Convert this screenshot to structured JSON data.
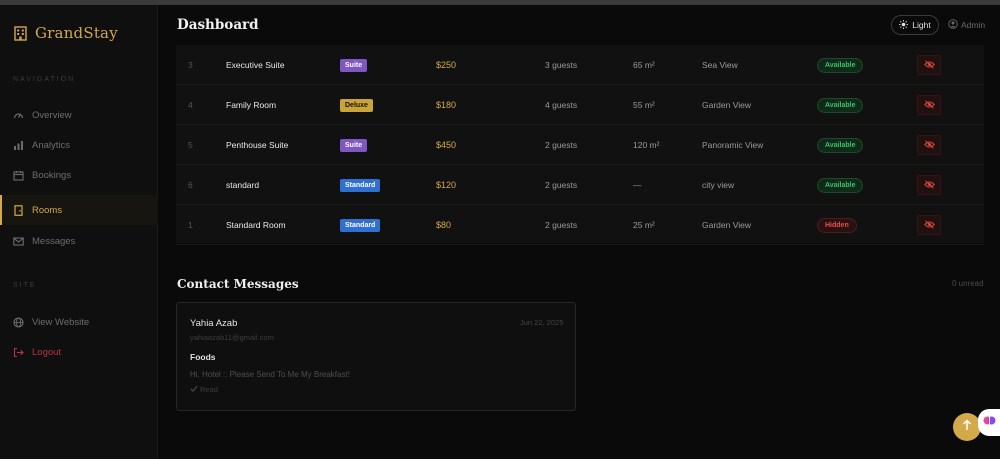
{
  "brand": {
    "name": "GrandStay",
    "accent": "#d4a94a"
  },
  "sidebar": {
    "section_main": "Navigation",
    "items": [
      {
        "label": "Overview",
        "icon": "gauge-icon"
      },
      {
        "label": "Analytics",
        "icon": "bar-chart-icon"
      },
      {
        "label": "Bookings",
        "icon": "calendar-icon"
      },
      {
        "label": "Rooms",
        "icon": "door-icon",
        "active": true
      },
      {
        "label": "Messages",
        "icon": "envelope-icon"
      }
    ],
    "section_site": "Site",
    "site_items": [
      {
        "label": "View Website",
        "icon": "globe-icon"
      },
      {
        "label": "Logout",
        "icon": "logout-icon"
      }
    ]
  },
  "header": {
    "title": "Dashboard",
    "theme_label": "Light",
    "user_label": "Admin"
  },
  "rooms": [
    {
      "id": "3",
      "name": "Executive Suite",
      "type": "Suite",
      "type_color": "#7e57c2",
      "price": "$250",
      "guests": "3 guests",
      "size": "65 m²",
      "view": "Sea View",
      "status": "Available"
    },
    {
      "id": "4",
      "name": "Family Room",
      "type": "Deluxe",
      "type_color": "#c9a43a",
      "price": "$180",
      "guests": "4 guests",
      "size": "55 m²",
      "view": "Garden View",
      "status": "Available"
    },
    {
      "id": "5",
      "name": "Penthouse Suite",
      "type": "Suite",
      "type_color": "#7e57c2",
      "price": "$450",
      "guests": "2 guests",
      "size": "120 m²",
      "view": "Panoramic View",
      "status": "Available"
    },
    {
      "id": "6",
      "name": "standard",
      "type": "Standard",
      "type_color": "#2f6fd0",
      "price": "$120",
      "guests": "2 guests",
      "size": "—",
      "view": "city view",
      "status": "Available"
    },
    {
      "id": "1",
      "name": "Standard Room",
      "type": "Standard",
      "type_color": "#2f6fd0",
      "price": "$80",
      "guests": "2 guests",
      "size": "25 m²",
      "view": "Garden View",
      "status": "Hidden"
    }
  ],
  "status_colors": {
    "Available": {
      "text": "#3fbf6a",
      "bg": "#0f2a18",
      "border": "#1e4a2c"
    },
    "Hidden": {
      "text": "#e5534b",
      "bg": "#2a1010",
      "border": "#4a1e1e"
    }
  },
  "messages": {
    "title": "Contact Messages",
    "unread_label": "0 unread",
    "items": [
      {
        "name": "Yahia Azab",
        "date": "Jun 22, 2025",
        "email": "yahiaazab11@gmail.com",
        "subject": "Foods",
        "body": "Hi, Hotel :: Please Send To Me My Breakfast!",
        "read_label": "Read"
      }
    ]
  }
}
